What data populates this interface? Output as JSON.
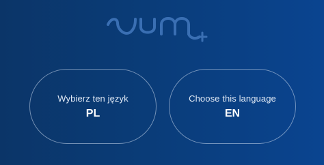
{
  "brand": {
    "logo_icon": "sum-logo-icon",
    "color": "#3a6fb3"
  },
  "languages": [
    {
      "prompt": "Wybierz ten język",
      "code": "PL"
    },
    {
      "prompt": "Choose this language",
      "code": "EN"
    }
  ],
  "colors": {
    "background_start": "#0b3568",
    "background_end": "#0a4490",
    "card_border": "#c8d7eb",
    "text": "#ffffff"
  }
}
